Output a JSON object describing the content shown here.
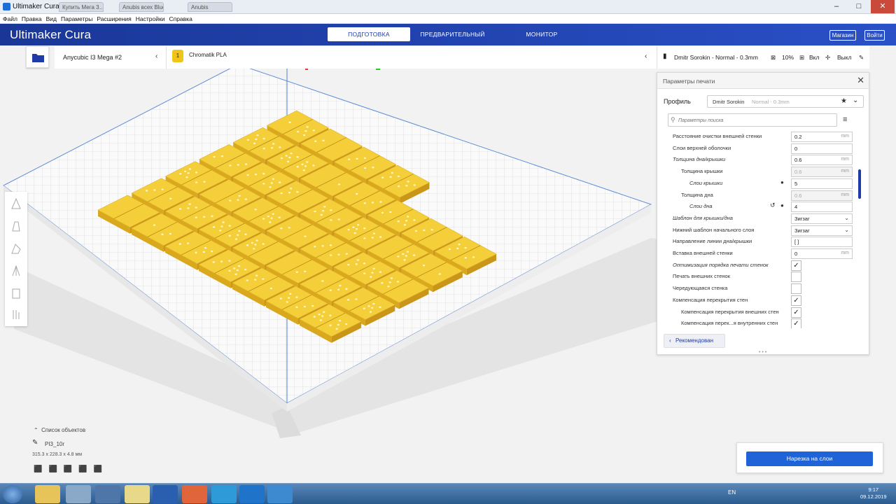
{
  "window": {
    "title": "Ultimaker Cura",
    "browser_tabs": [
      "Ultimaker Cura",
      "Купить Мега 3…",
      "Anubis всех Blue Пусто т…",
      "Anubis"
    ]
  },
  "menu": [
    "Файл",
    "Правка",
    "Вид",
    "Параметры",
    "Расширения",
    "Настройки",
    "Справка"
  ],
  "header": {
    "logo_bold": "Ultimaker",
    "logo_light": " Cura",
    "tabs": [
      "ПОДГОТОВКА",
      "ПРЕДВАРИТЕЛЬНЫЙ ПРОСМОТР",
      "МОНИТОР"
    ],
    "marketplace": "Магазин",
    "login": "Войти"
  },
  "machine": {
    "name": "Anycubic I3 Mega #2"
  },
  "material": {
    "name": "Chromatik PLA",
    "extruder": "1"
  },
  "profile_bar": {
    "profile": "Dmitr Sorokin - Normal - 0.3mm",
    "infill": "10%",
    "support": "Вкл",
    "adhesion": "Выкл"
  },
  "settings": {
    "title": "Параметры печати",
    "profile_label": "Профиль",
    "profile_name": "Dmitr Sorokin",
    "profile_suffix": "Normal - 0.3mm",
    "search_placeholder": "Параметры поиска",
    "rows": [
      {
        "label": "Расстояние очистки внешней стенки",
        "value": "0.2",
        "unit": "mm"
      },
      {
        "label": "Слои верхней оболочки",
        "value": "0",
        "unit": ""
      },
      {
        "label": "Толщина дна/крышки",
        "value": "0.6",
        "unit": "mm"
      },
      {
        "label": "Толщина крышки",
        "value": "0.6",
        "unit": "mm"
      },
      {
        "label": "Слои крышки",
        "value": "5",
        "unit": ""
      },
      {
        "label": "Толщина дна",
        "value": "0.6",
        "unit": "mm"
      },
      {
        "label": "Слои дна",
        "value": "4",
        "unit": ""
      },
      {
        "label": "Шаблон для крышки/дна",
        "value": "Зигзаг",
        "unit": ""
      },
      {
        "label": "Нижний шаблон начального слоя",
        "value": "Зигзаг",
        "unit": ""
      },
      {
        "label": "Направление линии дна/крышки",
        "value": "[ ]",
        "unit": ""
      },
      {
        "label": "Вставка внешней стенки",
        "value": "0",
        "unit": "mm"
      },
      {
        "label": "Оптимизация порядка печати стенок",
        "value": "✓",
        "unit": ""
      },
      {
        "label": "Печать внешних стенок",
        "value": "",
        "unit": ""
      },
      {
        "label": "Чередующаяся стенка",
        "value": "",
        "unit": ""
      },
      {
        "label": "Компенсация перекрытия стен",
        "value": "✓",
        "unit": ""
      },
      {
        "label": "Компенсация перекрытия внешних стен",
        "value": "✓",
        "unit": ""
      },
      {
        "label": "Компенсация перек...я внутренних стен",
        "value": "✓",
        "unit": ""
      }
    ],
    "recommended": "Рекомендован"
  },
  "object": {
    "list_label": "Список объектов",
    "name": "PI3_10r",
    "dimensions": "315.3 x 228.3 x 4.8 мм"
  },
  "slice_button": "Нарезка на слои",
  "taskbar": {
    "lang": "EN",
    "time": "9:17",
    "date": "09.12.2019"
  },
  "colors": {
    "brand": "#1f3ba8",
    "slice": "#1f63d8",
    "model": "#f5cf3a"
  }
}
